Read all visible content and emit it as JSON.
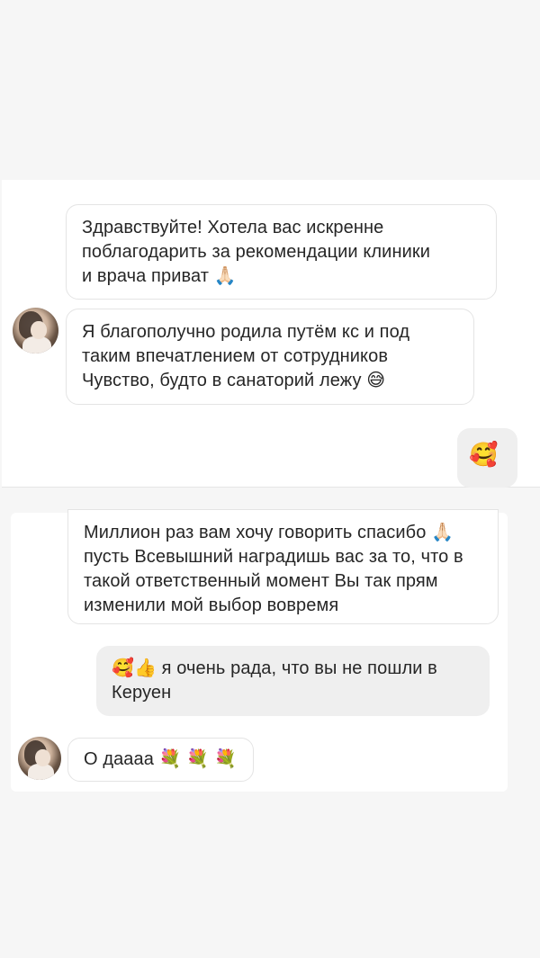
{
  "thread_top": {
    "messages": [
      {
        "text": "Здравствуйте! Хотела вас искренне\nпоблагодарить за рекомендации клиники\nи врача приват 🙏🏻"
      },
      {
        "text": "Я благополучно родила путём кс и под\nтаким впечатлением от сотрудников\nЧувство, будто в санаторий лежу 😅"
      },
      {
        "text": "🥰"
      }
    ]
  },
  "thread_bottom": {
    "messages": [
      {
        "text": "Миллион раз вам хочу говорить спасибо 🙏🏻\nпусть Всевышний наградишь вас за то, что в\nтакой ответственный момент Вы так прям\nизменили мой выбор вовремя"
      },
      {
        "text": "🥰👍 я очень рада, что вы не пошли в\nКеруен"
      },
      {
        "text": "О даааа 💐 💐 💐"
      }
    ]
  }
}
